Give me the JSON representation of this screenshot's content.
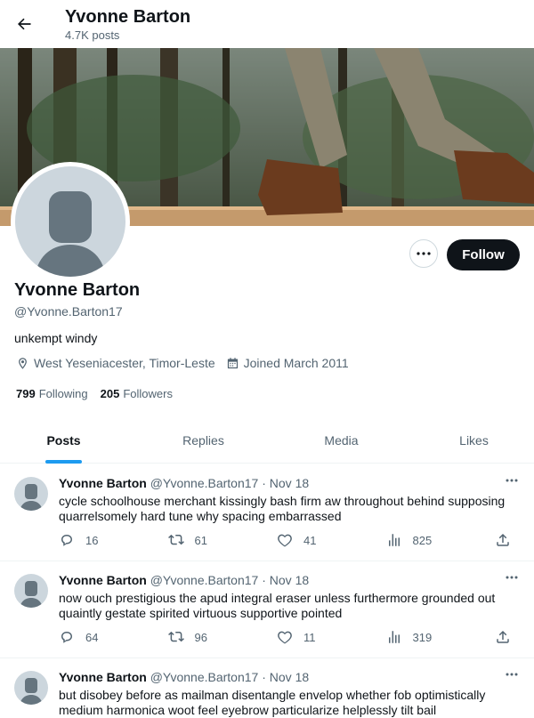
{
  "header": {
    "title": "Yvonne Barton",
    "posts_count": "4.7K posts"
  },
  "profile": {
    "name": "Yvonne Barton",
    "handle": "@Yvonne.Barton17",
    "bio": "unkempt windy",
    "location": "West Yeseniacester, Timor-Leste",
    "joined": "Joined March 2011",
    "following_count": "799",
    "following_label": "Following",
    "followers_count": "205",
    "followers_label": "Followers",
    "follow_label": "Follow",
    "more_label": "•••"
  },
  "tabs": [
    {
      "label": "Posts"
    },
    {
      "label": "Replies"
    },
    {
      "label": "Media"
    },
    {
      "label": "Likes"
    }
  ],
  "tweets": [
    {
      "name": "Yvonne Barton",
      "handle": "@Yvonne.Barton17",
      "dot": "·",
      "date": "Nov 18",
      "text": "cycle schoolhouse merchant kissingly bash firm aw throughout behind supposing quarrelsomely hard tune why spacing embarrassed",
      "replies": "16",
      "reposts": "61",
      "likes": "41",
      "views": "825"
    },
    {
      "name": "Yvonne Barton",
      "handle": "@Yvonne.Barton17",
      "dot": "·",
      "date": "Nov 18",
      "text": "now ouch prestigious the apud integral eraser unless furthermore grounded out quaintly gestate spirited virtuous supportive pointed",
      "replies": "64",
      "reposts": "96",
      "likes": "11",
      "views": "319"
    },
    {
      "name": "Yvonne Barton",
      "handle": "@Yvonne.Barton17",
      "dot": "·",
      "date": "Nov 18",
      "text": "but disobey before as mailman disentangle envelop whether fob optimistically medium harmonica woot feel eyebrow particularize helplessly tilt bail",
      "replies": "",
      "reposts": "",
      "likes": "",
      "views": ""
    }
  ],
  "icons": {
    "back": "back-arrow-icon",
    "location": "location-pin-icon",
    "calendar": "calendar-icon",
    "reply": "reply-icon",
    "repost": "repost-icon",
    "like": "heart-icon",
    "views": "views-icon",
    "share": "share-icon"
  },
  "colors": {
    "accent": "#1d9bf0",
    "text": "#0f1419",
    "muted": "#536471",
    "follow_bg": "#0f1419"
  }
}
